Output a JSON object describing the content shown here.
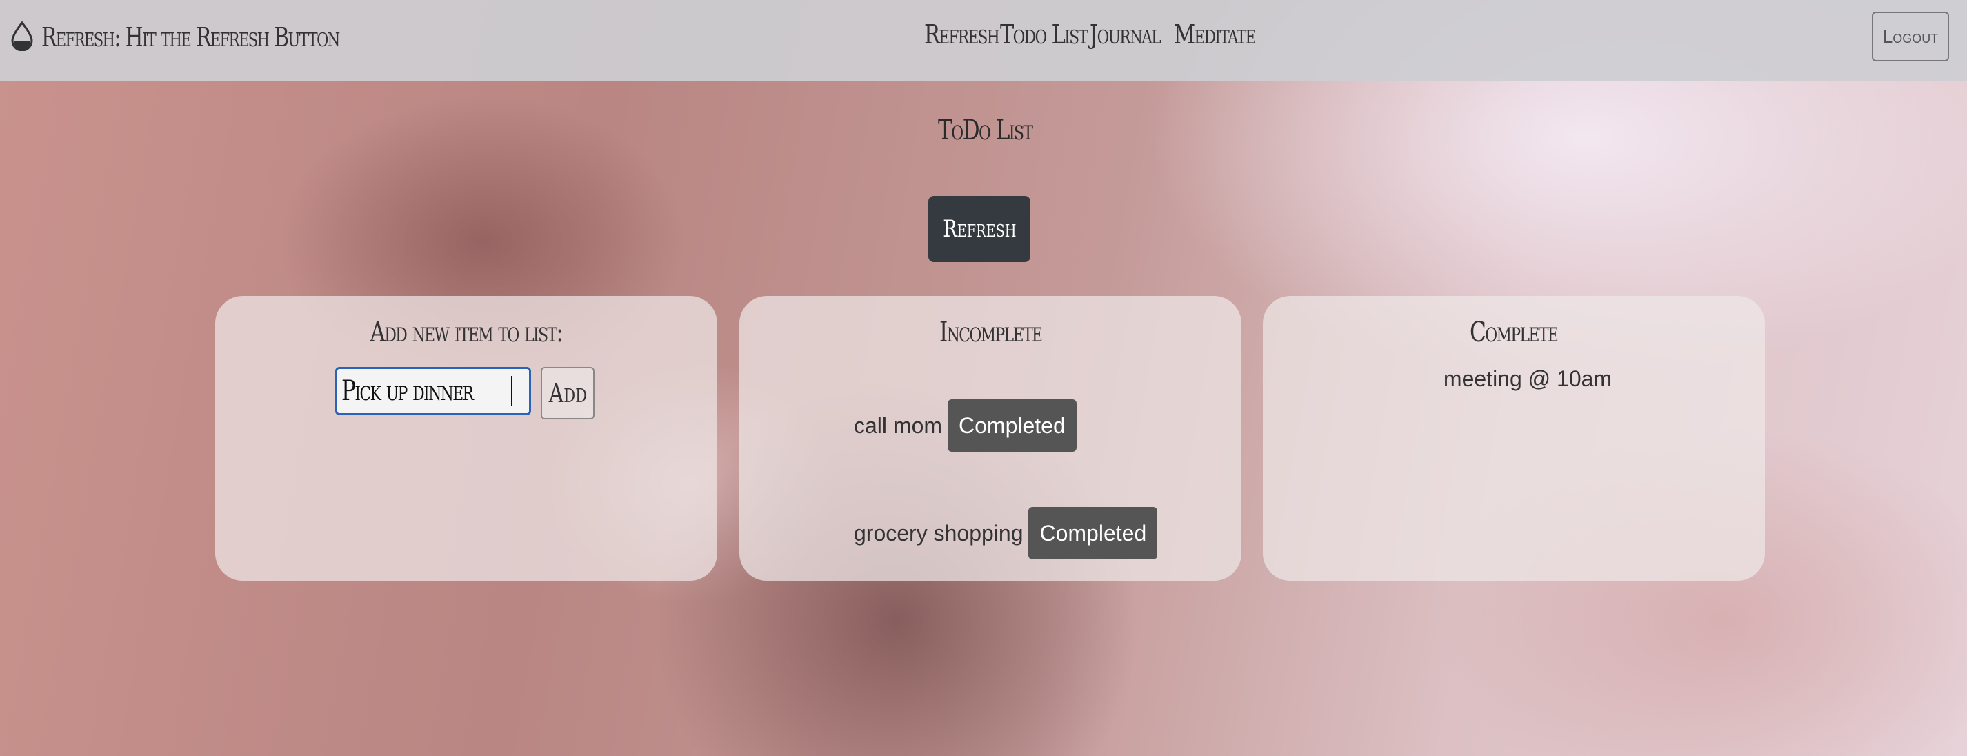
{
  "navbar": {
    "brand_icon": "droplet-icon",
    "brand_title": "Refresh: Hit the Refresh Button",
    "links": [
      "Refresh",
      "Todo List",
      "Journal",
      "Meditate"
    ],
    "logout_label": "Logout"
  },
  "page": {
    "title": "ToDo List",
    "refresh_label": "Refresh"
  },
  "add_card": {
    "title": "Add new item to list:",
    "input_value": "Pick up dinner",
    "add_label": "Add"
  },
  "incomplete_card": {
    "title": "Incomplete",
    "items": [
      {
        "text": "call mom",
        "button": "Completed"
      },
      {
        "text": "grocery shopping",
        "button": "Completed"
      }
    ]
  },
  "complete_card": {
    "title": "Complete",
    "items": [
      "meeting @ 10am"
    ]
  },
  "colors": {
    "navbar_bg": "#cdcdd2",
    "dark_button": "#343a40",
    "completed_button": "#555555",
    "input_focus_border": "#2b63b8"
  }
}
